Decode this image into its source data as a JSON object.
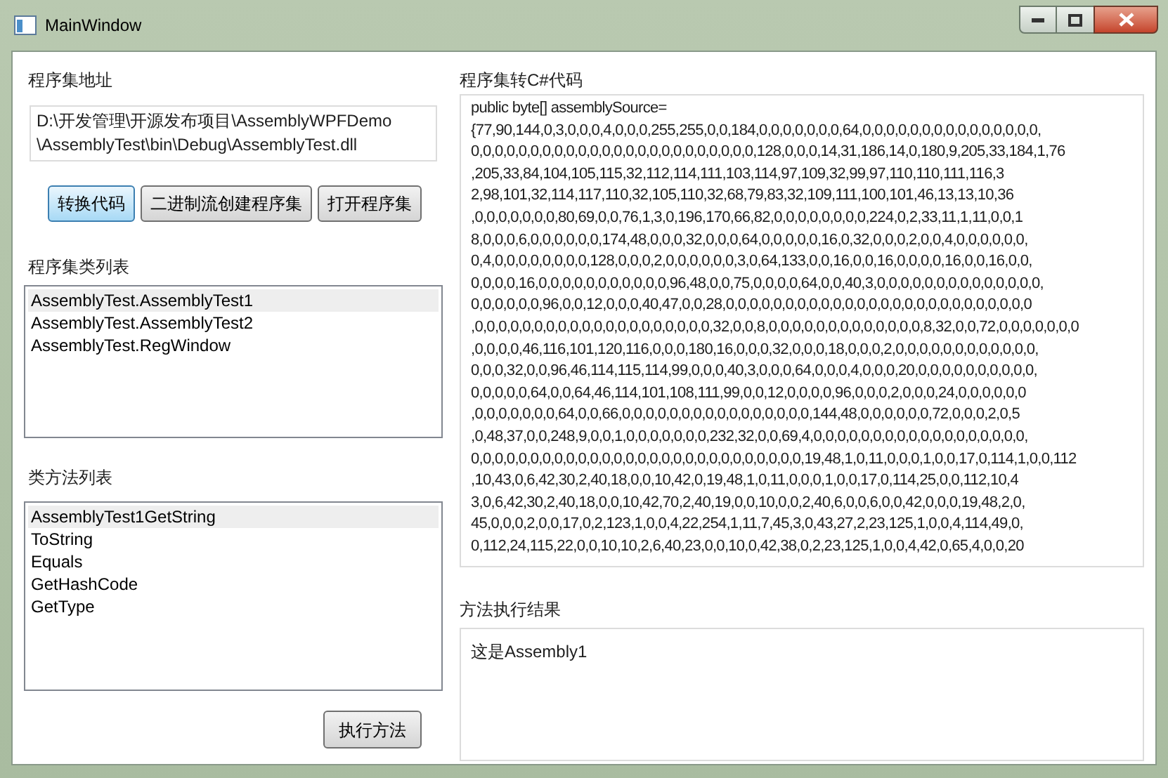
{
  "window": {
    "title": "MainWindow"
  },
  "assembly_path": {
    "label": "程序集地址",
    "value_lines": [
      "D:\\开发管理\\开源发布项目\\AssemblyWPFDemo",
      "\\AssemblyTest\\bin\\Debug\\AssemblyTest.dll"
    ]
  },
  "buttons": [
    {
      "label": "转换代码",
      "focused": true
    },
    {
      "label": "二进制流创建程序集",
      "focused": false
    },
    {
      "label": "打开程序集",
      "focused": false
    }
  ],
  "class_list": {
    "label": "程序集类列表",
    "items": [
      {
        "text": "AssemblyTest.AssemblyTest1",
        "selected": true
      },
      {
        "text": "AssemblyTest.AssemblyTest2",
        "selected": false
      },
      {
        "text": "AssemblyTest.RegWindow",
        "selected": false
      }
    ]
  },
  "method_list": {
    "label": "类方法列表",
    "items": [
      {
        "text": "AssemblyTest1GetString",
        "selected": true
      },
      {
        "text": "ToString",
        "selected": false
      },
      {
        "text": "Equals",
        "selected": false
      },
      {
        "text": "GetHashCode",
        "selected": false
      },
      {
        "text": "GetType",
        "selected": false
      }
    ]
  },
  "execute_button": {
    "label": "执行方法"
  },
  "code": {
    "label": "程序集转C#代码",
    "lines": [
      "public byte[] assemblySource=",
      "{77,90,144,0,3,0,0,0,4,0,0,0,255,255,0,0,184,0,0,0,0,0,0,0,64,0,0,0,0,0,0,0,0,0,0,0,0,0,0,0,",
      "0,0,0,0,0,0,0,0,0,0,0,0,0,0,0,0,0,0,0,0,0,0,0,0,128,0,0,0,14,31,186,14,0,180,9,205,33,184,1,76",
      ",205,33,84,104,105,115,32,112,114,111,103,114,97,109,32,99,97,110,110,111,116,3",
      "2,98,101,32,114,117,110,32,105,110,32,68,79,83,32,109,111,100,101,46,13,13,10,36",
      ",0,0,0,0,0,0,0,80,69,0,0,76,1,3,0,196,170,66,82,0,0,0,0,0,0,0,0,224,0,2,33,11,1,11,0,0,1",
      "8,0,0,0,6,0,0,0,0,0,0,174,48,0,0,0,32,0,0,0,64,0,0,0,0,0,16,0,32,0,0,0,2,0,0,4,0,0,0,0,0,0,",
      "0,4,0,0,0,0,0,0,0,0,128,0,0,0,2,0,0,0,0,0,0,3,0,64,133,0,0,16,0,0,16,0,0,0,0,16,0,0,16,0,0,",
      "0,0,0,0,16,0,0,0,0,0,0,0,0,0,0,0,96,48,0,0,75,0,0,0,0,64,0,0,40,3,0,0,0,0,0,0,0,0,0,0,0,0,0,0,",
      "0,0,0,0,0,0,96,0,0,12,0,0,0,40,47,0,0,28,0,0,0,0,0,0,0,0,0,0,0,0,0,0,0,0,0,0,0,0,0,0,0,0,0,0",
      ",0,0,0,0,0,0,0,0,0,0,0,0,0,0,0,0,0,0,0,0,32,0,0,8,0,0,0,0,0,0,0,0,0,0,0,0,0,8,32,0,0,72,0,0,0,0,0,0,0",
      ",0,0,0,0,46,116,101,120,116,0,0,0,180,16,0,0,0,32,0,0,0,18,0,0,0,2,0,0,0,0,0,0,0,0,0,0,0,0,",
      "0,0,0,32,0,0,96,46,114,115,114,99,0,0,0,40,3,0,0,0,64,0,0,0,4,0,0,0,20,0,0,0,0,0,0,0,0,0,0,",
      "0,0,0,0,0,64,0,0,64,46,114,101,108,111,99,0,0,12,0,0,0,0,96,0,0,0,2,0,0,0,24,0,0,0,0,0,0",
      ",0,0,0,0,0,0,0,64,0,0,66,0,0,0,0,0,0,0,0,0,0,0,0,0,0,0,0,144,48,0,0,0,0,0,0,72,0,0,0,2,0,5",
      ",0,48,37,0,0,248,9,0,0,1,0,0,0,0,0,0,0,232,32,0,0,69,4,0,0,0,0,0,0,0,0,0,0,0,0,0,0,0,0,0,0,",
      "0,0,0,0,0,0,0,0,0,0,0,0,0,0,0,0,0,0,0,0,0,0,0,0,0,0,0,0,19,48,1,0,11,0,0,0,1,0,0,17,0,114,1,0,0,112",
      ",10,43,0,6,42,30,2,40,18,0,0,10,42,0,19,48,1,0,11,0,0,0,1,0,0,17,0,114,25,0,0,112,10,4",
      "3,0,6,42,30,2,40,18,0,0,10,42,70,2,40,19,0,0,10,0,0,2,40,6,0,0,6,0,0,42,0,0,0,19,48,2,0,",
      "45,0,0,0,2,0,0,17,0,2,123,1,0,0,4,22,254,1,11,7,45,3,0,43,27,2,23,125,1,0,0,4,114,49,0,",
      "0,112,24,115,22,0,0,10,10,2,6,40,23,0,0,10,0,42,38,0,2,23,125,1,0,0,4,42,0,65,4,0,0,20"
    ]
  },
  "result": {
    "label": "方法执行结果",
    "value": "这是Assembly1"
  }
}
